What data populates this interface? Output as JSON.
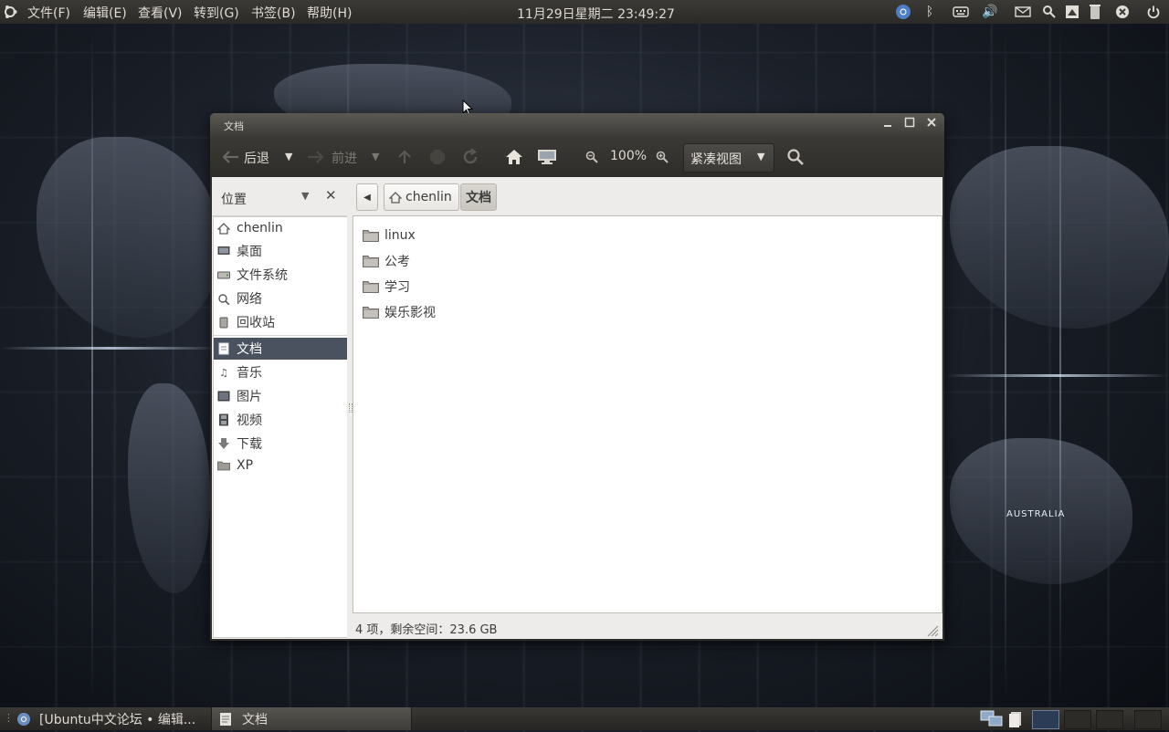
{
  "top_panel": {
    "menus": [
      "文件(F)",
      "编辑(E)",
      "查看(V)",
      "转到(G)",
      "书签(B)",
      "帮助(H)"
    ],
    "clock": "11月29日星期二 23:49:27",
    "tray_icons": [
      "chromium-icon",
      "bluetooth-icon",
      "keyboard-icon",
      "volume-icon",
      "mail-icon",
      "search-icon",
      "screenshot-icon",
      "trash-icon",
      "close-circle-icon",
      "power-icon"
    ]
  },
  "desktop": {
    "map_label": "AUSTRALIA"
  },
  "window": {
    "title": "文档",
    "toolbar": {
      "back": "后退",
      "forward": "前进",
      "zoom": "100%",
      "view_mode": "紧凑视图"
    },
    "sidebar": {
      "title": "位置",
      "items": [
        {
          "label": "chenlin",
          "icon": "home-icon"
        },
        {
          "label": "桌面",
          "icon": "desktop-icon"
        },
        {
          "label": "文件系统",
          "icon": "drive-icon"
        },
        {
          "label": "网络",
          "icon": "network-icon"
        },
        {
          "label": "回收站",
          "icon": "trash-icon"
        },
        {
          "label": "文档",
          "icon": "document-icon",
          "active": true
        },
        {
          "label": "音乐",
          "icon": "music-icon"
        },
        {
          "label": "图片",
          "icon": "picture-icon"
        },
        {
          "label": "视频",
          "icon": "video-icon"
        },
        {
          "label": "下载",
          "icon": "download-icon"
        },
        {
          "label": "XP",
          "icon": "folder-icon"
        }
      ]
    },
    "pathbar": {
      "home": "chenlin",
      "current": "文档"
    },
    "files": [
      "linux",
      "公考",
      "学习",
      "娱乐影视"
    ],
    "status": "4 项，剩余空间：23.6 GB"
  },
  "bottom_panel": {
    "tasks": [
      {
        "label": "[Ubuntu中文论坛 • 编辑..."
      },
      {
        "label": "文档",
        "active": true
      }
    ]
  }
}
